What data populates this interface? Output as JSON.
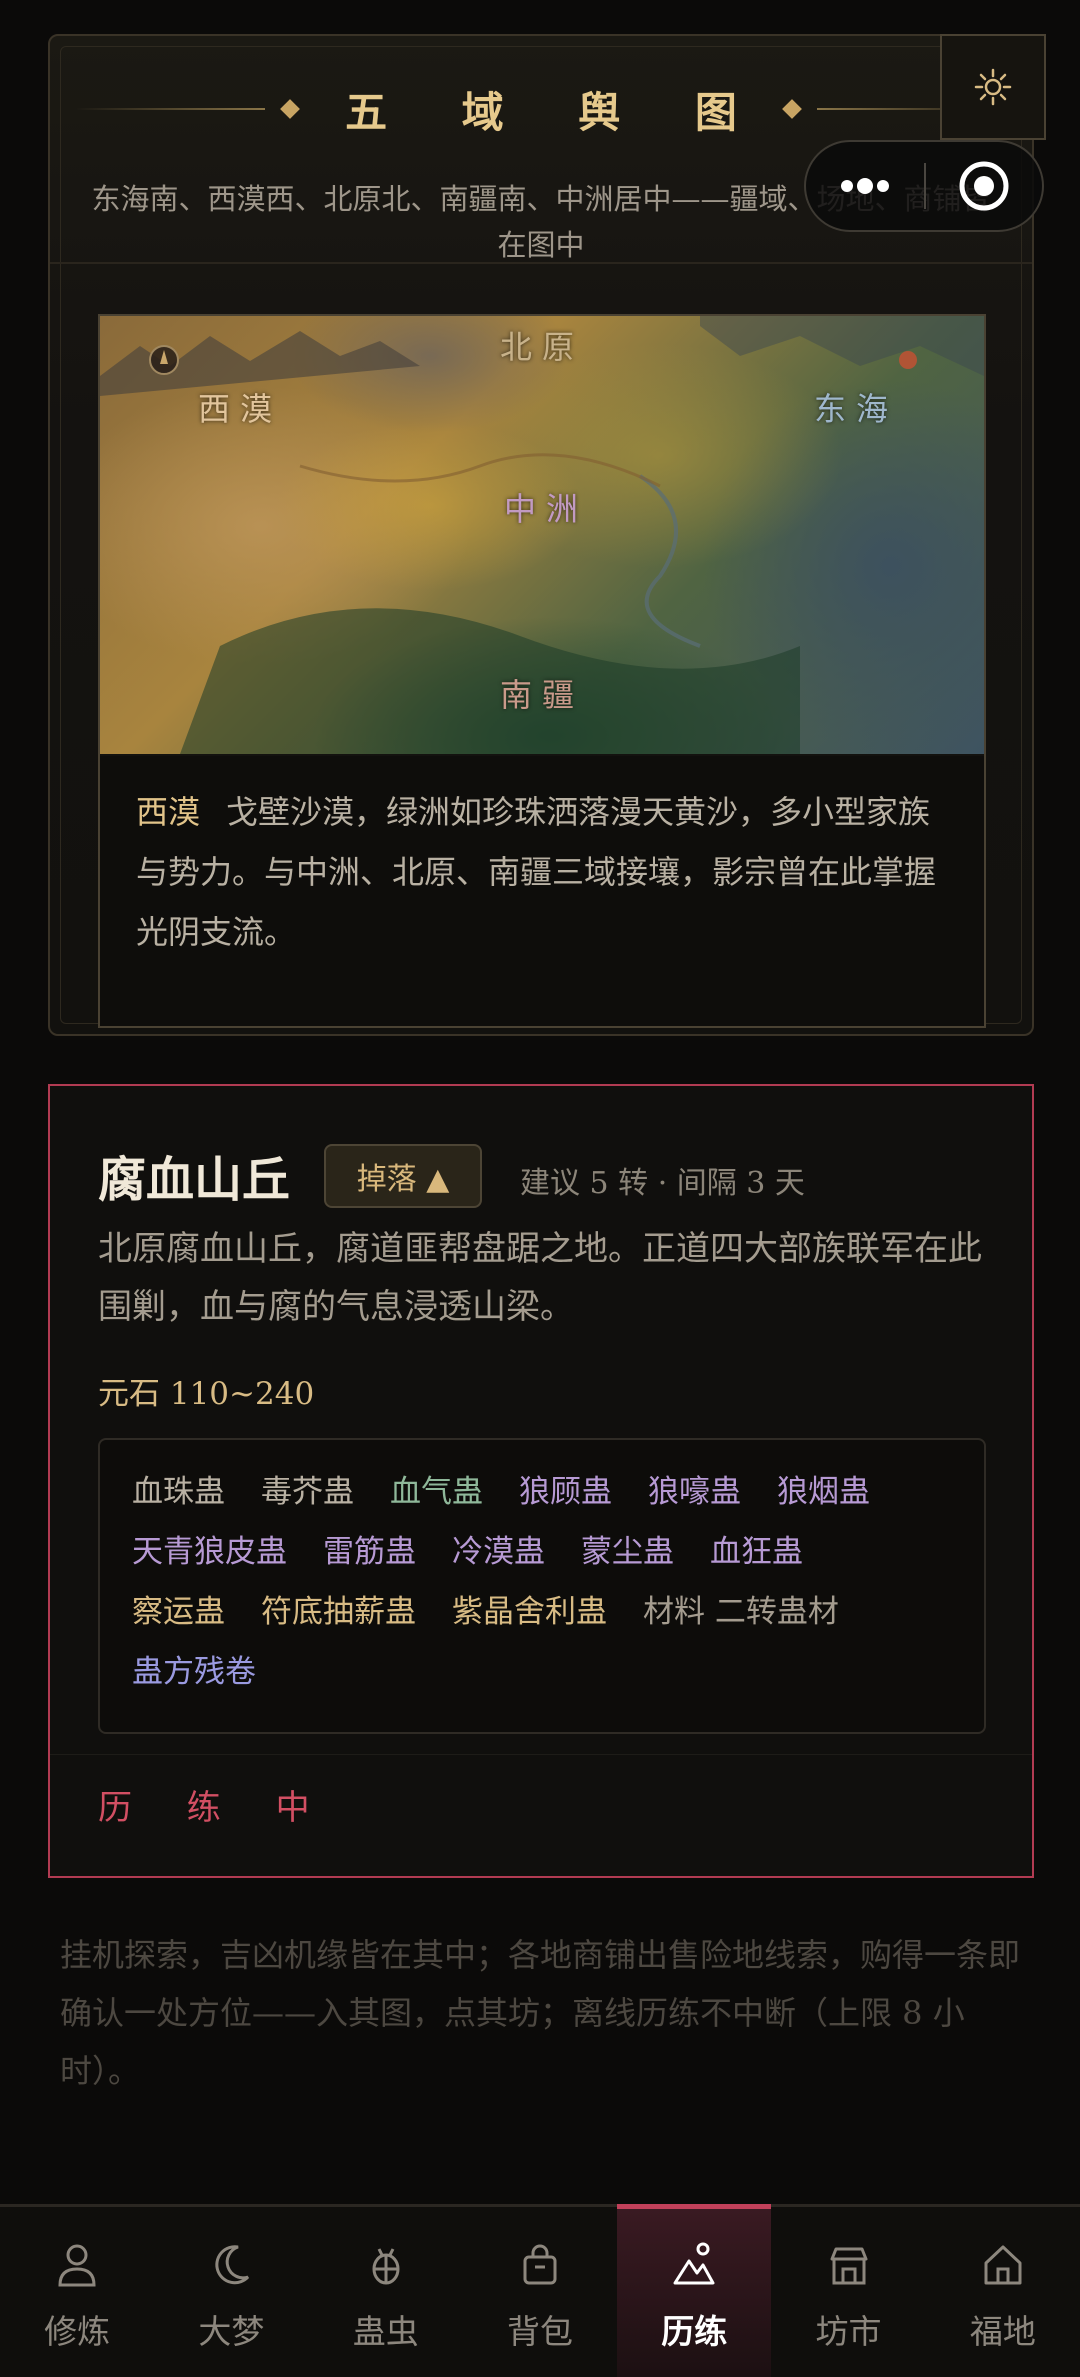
{
  "map_panel": {
    "title": "五 域 舆 图",
    "subtitle": "东海南、西漠西、北原北、南疆南、中洲居中——疆域、场地、商铺皆在图中",
    "regions": {
      "north": "北原",
      "west": "西漠",
      "east": "东海",
      "center": "中洲",
      "south": "南疆"
    },
    "selected_region": {
      "name": "西漠",
      "description": "戈壁沙漠，绿洲如珍珠洒落漫天黄沙，多小型家族与势力。与中洲、北原、南疆三域接壤，影宗曾在此掌握光阴支流。"
    }
  },
  "location": {
    "name": "腐血山丘",
    "drop_button": "掉落 ▲",
    "meta": "建议 5 转 · 间隔 3 天",
    "description": "北原腐血山丘，腐道匪帮盘踞之地。正道四大部族联军在此围剿，血与腐的气息浸透山梁。",
    "reward": "元石 110~240",
    "drops": [
      {
        "label": "血珠蛊",
        "color": "#b9b1a3"
      },
      {
        "label": "毒芥蛊",
        "color": "#b9b1a3"
      },
      {
        "label": "血气蛊",
        "color": "#8fb89a"
      },
      {
        "label": "狼顾蛊",
        "color": "#b79ad4"
      },
      {
        "label": "狼嚎蛊",
        "color": "#b79ad4"
      },
      {
        "label": "狼烟蛊",
        "color": "#b79ad4"
      },
      {
        "label": "天青狼皮蛊",
        "color": "#b79ad4"
      },
      {
        "label": "雷筋蛊",
        "color": "#b79ad4"
      },
      {
        "label": "冷漠蛊",
        "color": "#b79ad4"
      },
      {
        "label": "蒙尘蛊",
        "color": "#b79ad4"
      },
      {
        "label": "血狂蛊",
        "color": "#b79ad4"
      },
      {
        "label": "察运蛊",
        "color": "#d8bb84"
      },
      {
        "label": "符底抽薪蛊",
        "color": "#d8bb84"
      },
      {
        "label": "紫晶舍利蛊",
        "color": "#d8bb84"
      },
      {
        "label": "材料 二转蛊材",
        "color": "#a49c8f"
      },
      {
        "label": "蛊方残卷",
        "color": "#9a9ae0"
      }
    ],
    "status": "历 练 中"
  },
  "footer_note": "挂机探索，吉凶机缘皆在其中；各地商铺出售险地线索，购得一条即确认一处方位——入其图，点其坊；离线历练不中断（上限 8 小时）。",
  "nav": {
    "items": [
      {
        "label": "修炼",
        "icon": "person-icon"
      },
      {
        "label": "大梦",
        "icon": "moon-icon"
      },
      {
        "label": "蛊虫",
        "icon": "bug-icon"
      },
      {
        "label": "背包",
        "icon": "bag-icon"
      },
      {
        "label": "历练",
        "icon": "mountain-icon"
      },
      {
        "label": "坊市",
        "icon": "shop-icon"
      },
      {
        "label": "福地",
        "icon": "home-icon"
      }
    ],
    "active": "历练"
  },
  "colors": {
    "accent_gold": "#e6c98c",
    "accent_red": "#c2405a",
    "background": "#0b0a09"
  }
}
